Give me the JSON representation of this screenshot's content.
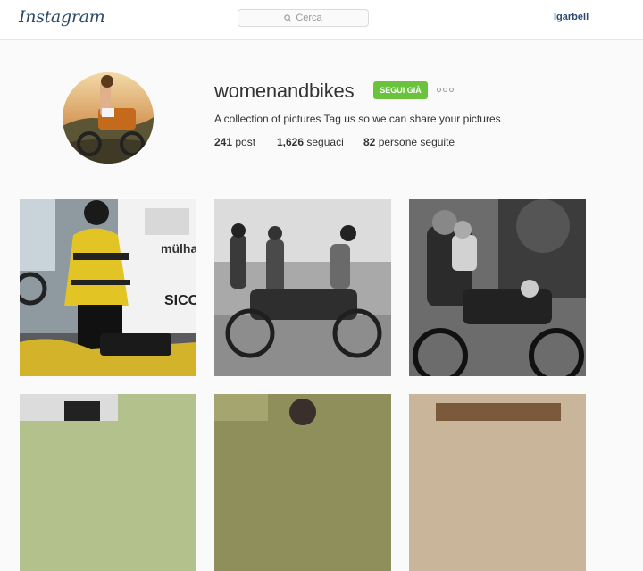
{
  "header": {
    "logo": "Instagram",
    "search_placeholder": "Cerca",
    "user": "lgarbell"
  },
  "profile": {
    "username": "womenandbikes",
    "follow_label": "SEGUI GIÀ",
    "bio": "A collection of pictures Tag us so we can share your pictures",
    "stats": {
      "posts_count": "241",
      "posts_label": "post",
      "followers_count": "1,626",
      "followers_label": "seguaci",
      "following_count": "82",
      "following_label": "persone seguite"
    }
  },
  "posts": [
    {
      "name": "post-yellow-jacket-rider"
    },
    {
      "name": "post-vintage-women-motorcycle"
    },
    {
      "name": "post-mother-child-motorcycle"
    },
    {
      "name": "post-row2-1"
    },
    {
      "name": "post-row2-2"
    },
    {
      "name": "post-row2-3"
    }
  ]
}
